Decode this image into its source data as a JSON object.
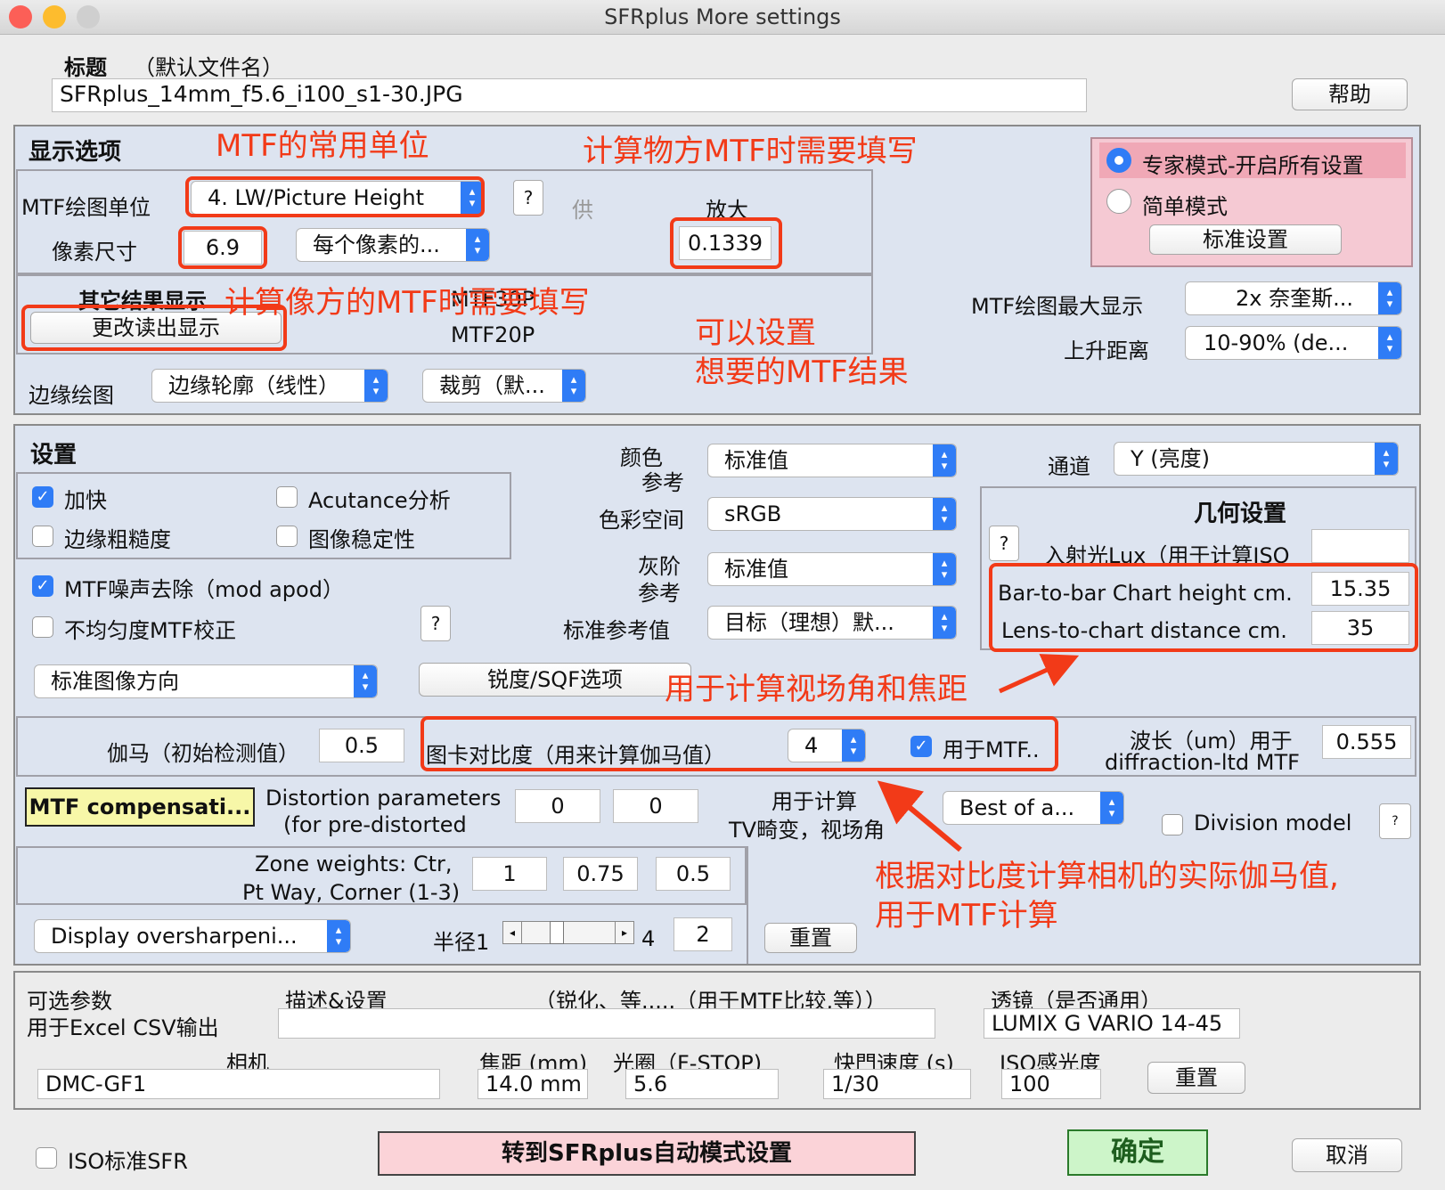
{
  "window": {
    "title": "SFRplus More settings"
  },
  "top": {
    "title_label": "标题",
    "title_hint": "（默认文件名）",
    "filename": "SFRplus_14mm_f5.6_i100_s1-30.JPG",
    "help_button": "帮助"
  },
  "display": {
    "heading": "显示选项",
    "mtf_unit_label": "MTF绘图单位",
    "mtf_unit_value": "4. LW/Picture Height",
    "q": "?",
    "supply": "供",
    "magnify_label": "放大",
    "magnify_value": "0.1339",
    "pixel_size_label": "像素尺寸",
    "pixel_size_value": "6.9",
    "per_pixel_value": "每个像素的...",
    "other_results_label": "其它结果显示",
    "change_readout_button": "更改读出显示",
    "mtf30p": "MTF30P",
    "mtf20p": "MTF20P",
    "edge_plot_label": "边缘绘图",
    "edge_plot_value": "边缘轮廓（线性）",
    "crop_value": "裁剪（默...",
    "expert_mode": "专家模式-开启所有设置",
    "simple_mode": "简单模式",
    "standard_settings_button": "标准设置",
    "mtf_max_label": "MTF绘图最大显示",
    "mtf_max_value": "2x 奈奎斯...",
    "rise_label": "上升距离",
    "rise_value": "10-90% (de..."
  },
  "settings": {
    "heading": "设置",
    "speedup": "加快",
    "acutance": "Acutance分析",
    "edge_roughness": "边缘粗糙度",
    "stability": "图像稳定性",
    "noise_removal": "MTF噪声去除（mod  apod）",
    "nonuniform": "不均匀度MTF校正",
    "q": "?",
    "orientation_value": "标准图像方向",
    "sharpness_button": "锐度/SQF选项",
    "color_ref_label_1": "颜色",
    "color_ref_label_2": "参考",
    "color_ref_value": "标准值",
    "color_space_label": "色彩空间",
    "color_space_value": "sRGB",
    "gray_ref_label_1": "灰阶",
    "gray_ref_label_2": "参考",
    "gray_ref_value": "标准值",
    "std_ref_label": "标准参考值",
    "std_ref_value": "目标（理想）默...",
    "channel_label": "通道",
    "channel_value": "Y (亮度)",
    "geometry_heading": "几何设置",
    "lux_label": "入射光Lux（用于计算ISO",
    "lux_value": "",
    "bar_height_label": "Bar-to-bar Chart height cm.",
    "bar_height_value": "15.35",
    "lens_distance_label": "Lens-to-chart distance cm.",
    "lens_distance_value": "35",
    "gamma_label": "伽马（初始检测值）",
    "gamma_value": "0.5",
    "contrast_label": "图卡对比度（用来计算伽马值）",
    "contrast_value": "4",
    "use_for_mtf": "用于MTF..",
    "wavelength_label_1": "波长（um）用于",
    "wavelength_label_2": "diffraction-ltd MTF",
    "wavelength_value": "0.555",
    "mtf_comp_button": "MTF compensati...",
    "distortion_label_1": "Distortion parameters",
    "distortion_label_2": "(for pre-distorted",
    "distortion_value_1": "0",
    "distortion_value_2": "0",
    "tv_label_1": "用于计算",
    "tv_label_2": "TV畸变，视场角",
    "best_of_value": "Best of a...",
    "division_model": "Division model",
    "zone_label_1": "Zone weights:  Ctr,",
    "zone_label_2": "Pt Way, Corner (1-3)",
    "zone_ctr": "1",
    "zone_pt": "0.75",
    "zone_corner": "0.5",
    "oversharp_value": "Display oversharpeni...",
    "radius_label": "半径1",
    "radius_max": "4",
    "radius_value": "2",
    "reset_button": "重置"
  },
  "optional": {
    "label_1": "可选参数",
    "label_2": "用于Excel CSV输出",
    "desc_label": "描述&设置",
    "desc_hint": "（锐化、等.....（用于MTF比较,等））",
    "desc_value": "",
    "lens_label": "透镜（是否通用）",
    "lens_value": "LUMIX G VARIO 14-45",
    "camera_label": "相机",
    "camera_value": "DMC-GF1",
    "focal_label": "焦距 (mm)",
    "focal_value": "14.0 mm",
    "aperture_label": "光圈（F-STOP)",
    "aperture_value": "5.6",
    "shutter_label": "快門速度 (s)",
    "shutter_value": "1/30",
    "iso_label": "ISO感光度",
    "iso_value": "100",
    "reset_button": "重置"
  },
  "bottom": {
    "iso_std_sfr": "ISO标准SFR",
    "goto_auto_button": "转到SFRplus自动模式设置",
    "ok_button": "确定",
    "cancel_button": "取消"
  },
  "annotations": {
    "mtf_unit": "MTF的常用单位",
    "object_mtf": "计算物方MTF时需要填写",
    "image_mtf": "计算像方的MTF时需要填写",
    "set_results_1": "可以设置",
    "set_results_2": "想要的MTF结果",
    "fov": "用于计算视场角和焦距",
    "gamma_1": "根据对比度计算相机的实际伽马值,",
    "gamma_2": "用于MTF计算"
  },
  "colors": {
    "accent": "#2f7cf6",
    "annotation_red": "#f23a18",
    "panel_blue": "#dde4f0",
    "expert_pink": "#f5c9d3",
    "mtf_comp_yellow": "#f7f7a8",
    "ok_green": "#cdf5c9",
    "goto_pink": "#fbd3d8"
  }
}
